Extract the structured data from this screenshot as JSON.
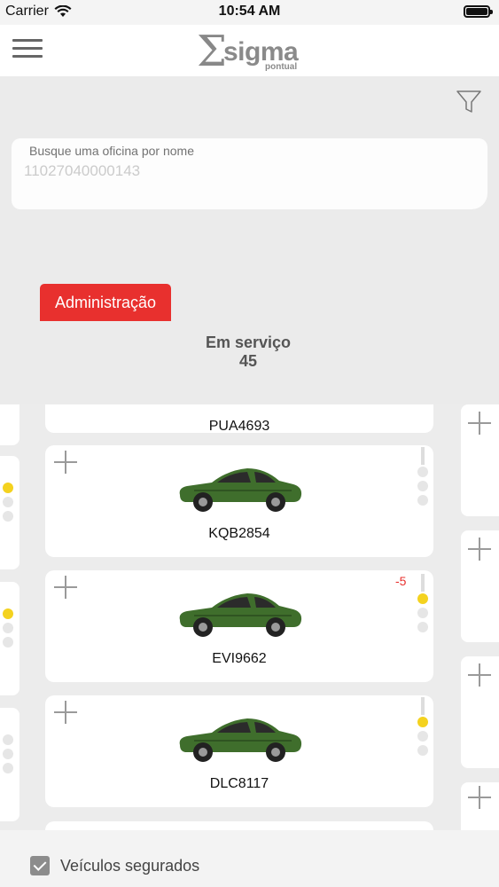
{
  "status_bar": {
    "carrier": "Carrier",
    "time": "10:54 AM"
  },
  "header": {
    "logo_word": "sigma",
    "logo_sub": "pontual",
    "menu_icon": "hamburger-menu-icon"
  },
  "filter": {
    "icon": "funnel-filter-icon"
  },
  "search": {
    "label": "Busque uma oficina por nome",
    "placeholder": "11027040000143",
    "value": ""
  },
  "admin_tab": {
    "label": "Administração"
  },
  "column": {
    "title": "Em serviço",
    "count": "45"
  },
  "cards": [
    {
      "plate": "PUA4693",
      "delay": ""
    },
    {
      "plate": "KQB2854",
      "delay": ""
    },
    {
      "plate": "EVI9662",
      "delay": "-5"
    },
    {
      "plate": "DLC8117",
      "delay": ""
    }
  ],
  "colors": {
    "accent": "#e8302e",
    "car_body": "#3f6e2c",
    "light_on": "#f4d21f"
  },
  "filters": {
    "insured_label": "Veículos segurados",
    "insured_checked": true
  }
}
